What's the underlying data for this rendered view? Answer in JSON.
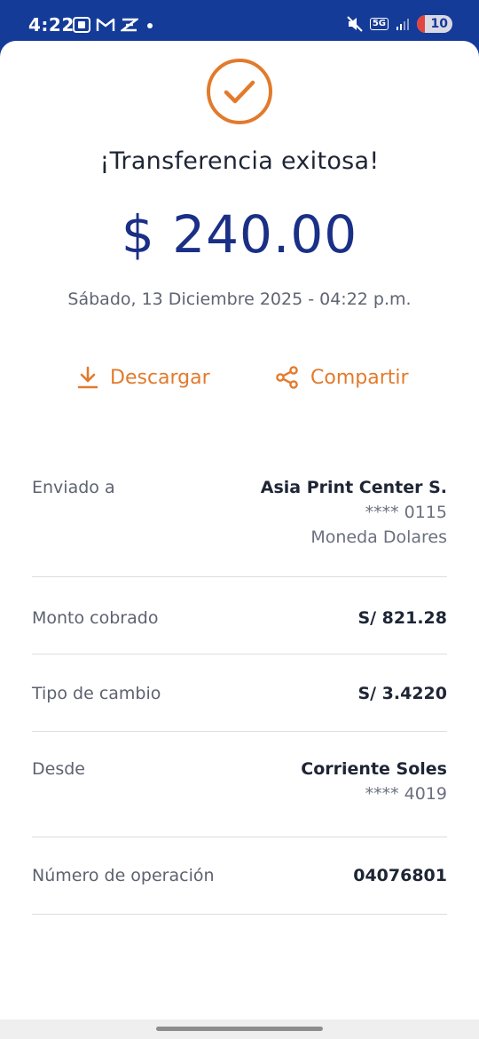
{
  "status_bar": {
    "time": "4:22",
    "network": "5G",
    "battery": "10",
    "notification_icons": [
      "screenshot-icon",
      "gmail-icon",
      "app-icon",
      "dot-icon"
    ],
    "system_icons": [
      "mute-icon",
      "signal-icon",
      "battery-icon"
    ]
  },
  "receipt": {
    "title": "¡Transferencia exitosa!",
    "amount": "$ 240.00",
    "datetime": "Sábado, 13 Diciembre 2025 - 04:22 p.m.",
    "actions": {
      "download_label": "Descargar",
      "share_label": "Compartir"
    },
    "details": {
      "sent_to": {
        "label": "Enviado a",
        "name": "Asia Print Center S.",
        "account": "**** 0115",
        "currency": "Moneda Dolares"
      },
      "charged_amount": {
        "label": "Monto cobrado",
        "value": "S/ 821.28"
      },
      "exchange_rate": {
        "label": "Tipo de cambio",
        "value": "S/ 3.4220"
      },
      "from": {
        "label": "Desde",
        "name": "Corriente Soles",
        "account": "**** 4019"
      },
      "operation_number": {
        "label": "Número de operación",
        "value": "04076801"
      }
    }
  },
  "colors": {
    "brand_blue": "#143b97",
    "amount_blue": "#1a2f86",
    "accent_orange": "#e27a2c",
    "text_dark": "#1e2534",
    "text_muted": "#5d6270"
  }
}
